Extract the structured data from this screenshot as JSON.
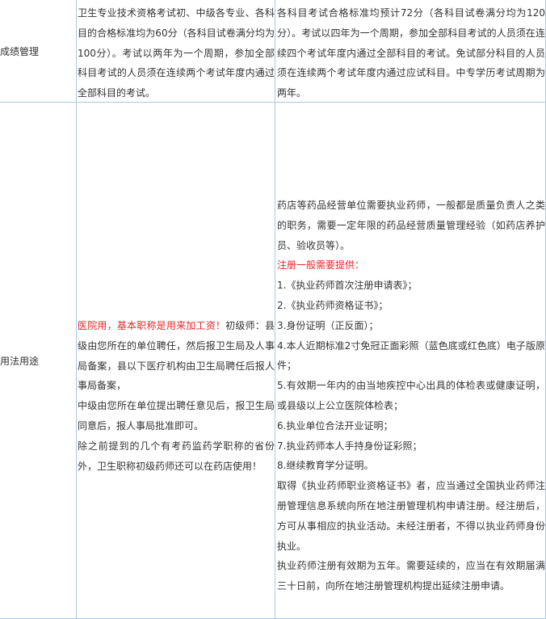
{
  "row1": {
    "label": "成绩管理",
    "col2": "卫生专业技术资格考试初、中级各专业、各科目的合格标准均为60分（各科目试卷满分均为100分）。考试以两年为一个周期，参加全部科目考试的人员须在连续两个考试年度内通过全部科目的考试。",
    "col3": "各科目考试合格标准均预计72分（各科目试卷满分均为120分）。考试以四年为一个周期，参加全部科目考试的人员须在连续四个考试年度内通过全部科目的考试。免试部分科目的人员须在连续两个考试年度内通过应试科目。中专学历考试周期为两年。"
  },
  "row2": {
    "label": "用法用途",
    "col2": {
      "highlight": "医院用，基本职称是用来加工资！",
      "lines": [
        "初级师：县级由您所在的单位聘任，然后报卫生局及人事局备案，县以下医疗机构由卫生局聘任后报人事局备案，",
        "中级由您所在单位提出聘任意见后，报卫生局同意后，报人事局批准即可。",
        "除之前提到的几个有考药监药学职称的省份外，卫生职称初级药师还可以在药店使用！"
      ]
    },
    "col3": {
      "intro": "药店等药品经营单位需要执业药师，一般都是质量负责人之类的职务，需要一定年限的药品经营质量管理经验（如药店养护员、验收员等）。",
      "red_heading": "注册一般需要提供：",
      "items": [
        "1.《执业药师首次注册申请表》；",
        "2.《执业药师资格证书》；",
        "3.身份证明（正反面）；",
        "4.本人近期标准2寸免冠正面彩照（蓝色底或红色底）电子版原件；",
        "5.有效期一年内的由当地疾控中心出具的体检表或健康证明，或县级以上公立医院体检表；",
        "6.执业单位合法开业证明；",
        "7.执业药师本人手持身份证彩照；",
        "8.继续教育学分证明。"
      ],
      "after": [
        "取得《执业药师职业资格证书》者，应当通过全国执业药师注册管理信息系统向所在地注册管理机构申请注册。经注册后，方可从事相应的执业活动。未经注册者，不得以执业药师身份执业。",
        "执业药师注册有效期为五年。需要延续的，应当在有效期届满三十日前，向所在地注册管理机构提出延续注册申请。"
      ]
    }
  }
}
